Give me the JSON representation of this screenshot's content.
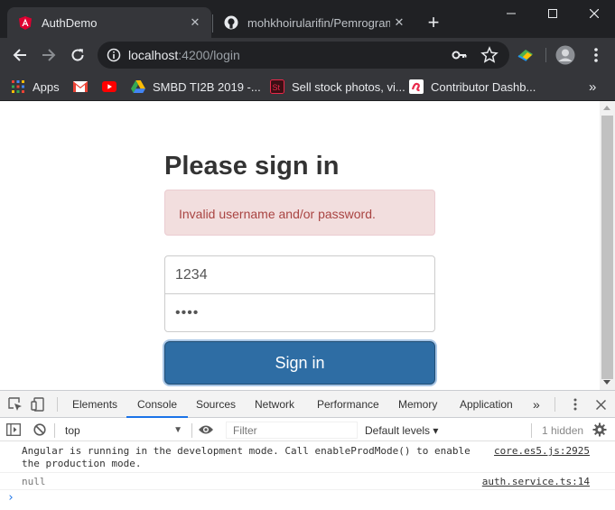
{
  "browser": {
    "tabs": [
      {
        "title": "AuthDemo",
        "icon": "angular-icon",
        "active": true
      },
      {
        "title": "mohkhoirularifin/Pemrograma",
        "icon": "github-icon",
        "active": false
      }
    ],
    "new_tab_label": "+",
    "address": {
      "host": "localhost",
      "path": ":4200/login"
    },
    "bookmarks": [
      {
        "label": "Apps",
        "icon": "apps-grid-icon"
      },
      {
        "label": "",
        "icon": "gmail-icon"
      },
      {
        "label": "",
        "icon": "youtube-icon"
      },
      {
        "label": "SMBD TI2B 2019 -...",
        "icon": "google-drive-icon"
      },
      {
        "label": "Sell stock photos, vi...",
        "icon": "adobe-stock-icon"
      },
      {
        "label": "Contributor Dashb...",
        "icon": "contributor-icon"
      }
    ],
    "bookmarks_overflow": "»"
  },
  "page": {
    "heading": "Please sign in",
    "alert": "Invalid username and/or password.",
    "username_value": "1234",
    "password_value": "••••",
    "submit_label": "Sign in"
  },
  "devtools": {
    "tabs": [
      "Elements",
      "Console",
      "Sources",
      "Network",
      "Performance",
      "Memory",
      "Application"
    ],
    "active_tab": "Console",
    "more": "»",
    "context": "top",
    "filter_placeholder": "Filter",
    "levels": "Default levels ▾",
    "hidden": "1 hidden",
    "messages": [
      {
        "text": "Angular is running in the development mode. Call enableProdMode() to enable\nthe production mode.",
        "source": "core.es5.js:2925"
      },
      {
        "text": "null",
        "source": "auth.service.ts:14"
      }
    ],
    "prompt": "›"
  },
  "colors": {
    "titlebar": "#202124",
    "toolbar": "#35363a",
    "alert_bg": "#f2dede",
    "alert_text": "#a94442",
    "button": "#2e6da4",
    "devtools_accent": "#1a73e8"
  }
}
